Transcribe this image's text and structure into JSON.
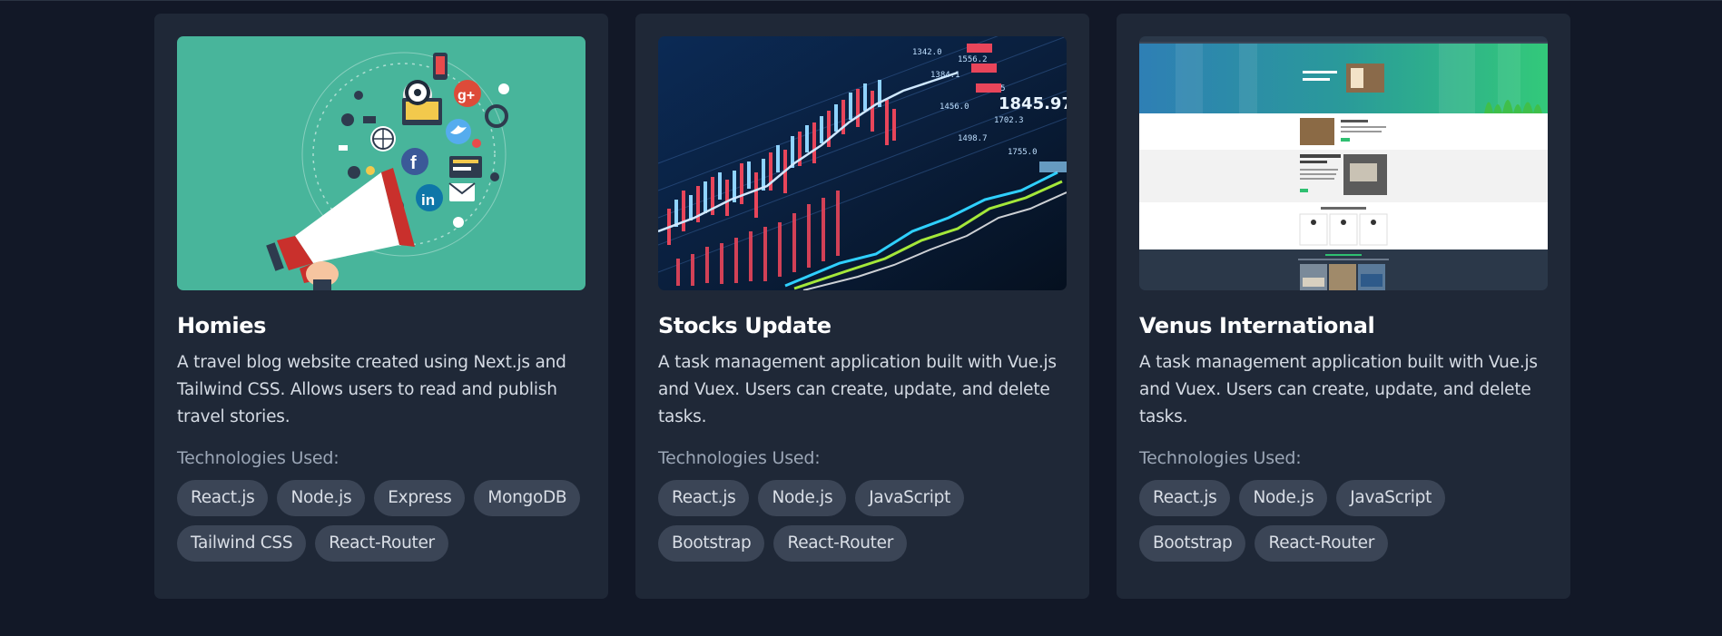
{
  "projects": [
    {
      "image": "marketing-megaphone-illustration",
      "title": "Homies",
      "description": "A travel blog website created using Next.js and Tailwind CSS. Allows users to read and publish travel stories.",
      "tech_heading": "Technologies Used:",
      "tags": [
        "React.js",
        "Node.js",
        "Express",
        "MongoDB",
        "Tailwind CSS",
        "React-Router"
      ]
    },
    {
      "image": "stock-market-chart-photo",
      "title": "Stocks Update",
      "description": "A task management application built with Vue.js and Vuex. Users can create, update, and delete tasks.",
      "tech_heading": "Technologies Used:",
      "tags": [
        "React.js",
        "Node.js",
        "JavaScript",
        "Bootstrap",
        "React-Router"
      ]
    },
    {
      "image": "website-screenshot-preview",
      "title": "Venus International",
      "description": "A task management application built with Vue.js and Vuex. Users can create, update, and delete tasks.",
      "tech_heading": "Technologies Used:",
      "tags": [
        "React.js",
        "Node.js",
        "JavaScript",
        "Bootstrap",
        "React-Router"
      ]
    }
  ],
  "colors": {
    "page_background": "#121827",
    "card_background": "#1f2837",
    "tag_background": "#3b4556",
    "heading_text": "#ffffff",
    "muted_text": "#9ba6b6",
    "teal": "#48b59b"
  }
}
